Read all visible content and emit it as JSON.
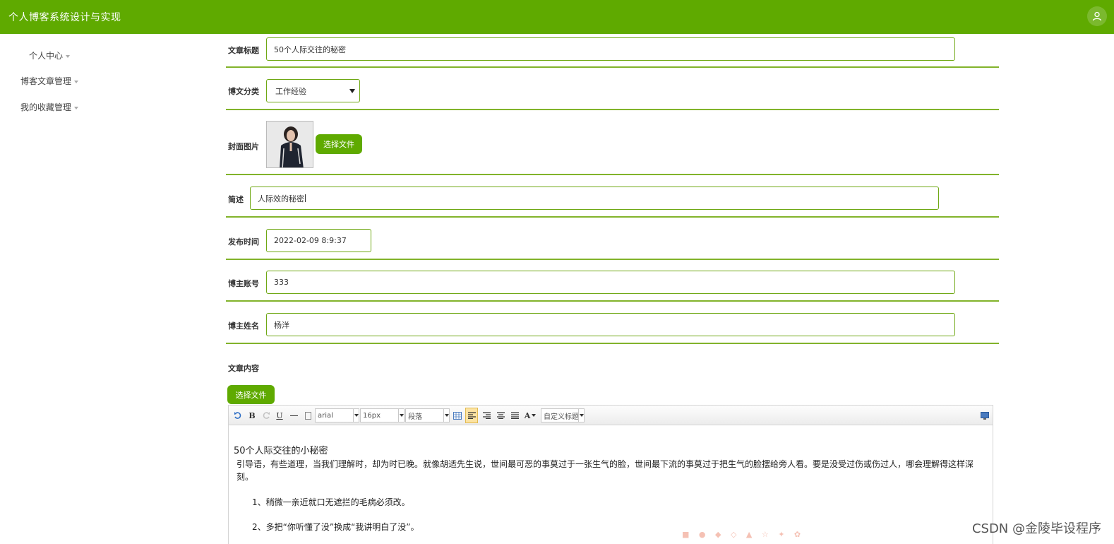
{
  "app": {
    "title": "个人博客系统设计与实现"
  },
  "sidebar": {
    "items": [
      {
        "label": "个人中心"
      },
      {
        "label": "博客文章管理"
      },
      {
        "label": "我的收藏管理"
      }
    ]
  },
  "form": {
    "title_label": "文章标题",
    "title_value": "50个人际交往的秘密",
    "category_label": "博文分类",
    "category_value": "工作经验",
    "cover_label": "封面图片",
    "choose_file": "选择文件",
    "summary_label": "简述",
    "summary_value": "人际效的秘密",
    "time_label": "发布时间",
    "time_value": "2022-02-09 8:9:37",
    "account_label": "博主账号",
    "account_value": "333",
    "name_label": "博主姓名",
    "name_value": "杨洋",
    "content_label": "文章内容",
    "content_choose_file": "选择文件"
  },
  "editor": {
    "font_family": "arial",
    "font_size": "16px",
    "paragraph": "段落",
    "custom_heading": "自定义标题",
    "bold": "B",
    "underline": "U",
    "font_color": "A",
    "content": {
      "heading": "50个人际交往的小秘密",
      "intro": "引导语，有些道理，当我们理解时，却为时已晚。就像胡适先生说，世间最可恶的事莫过于一张生气的脸，世间最下流的事莫过于把生气的脸摆给旁人看。要是没受过伤或伤过人，哪会理解得这样深刻。",
      "item1": "1、稍微一亲近就口无遮拦的毛病必须改。",
      "item2": "2、多把“你听懂了没”换成“我讲明白了没”。"
    }
  },
  "watermark": "CSDN @金陵毕设程序",
  "colors": {
    "brand": "#5faa00",
    "border": "#82b32b"
  }
}
